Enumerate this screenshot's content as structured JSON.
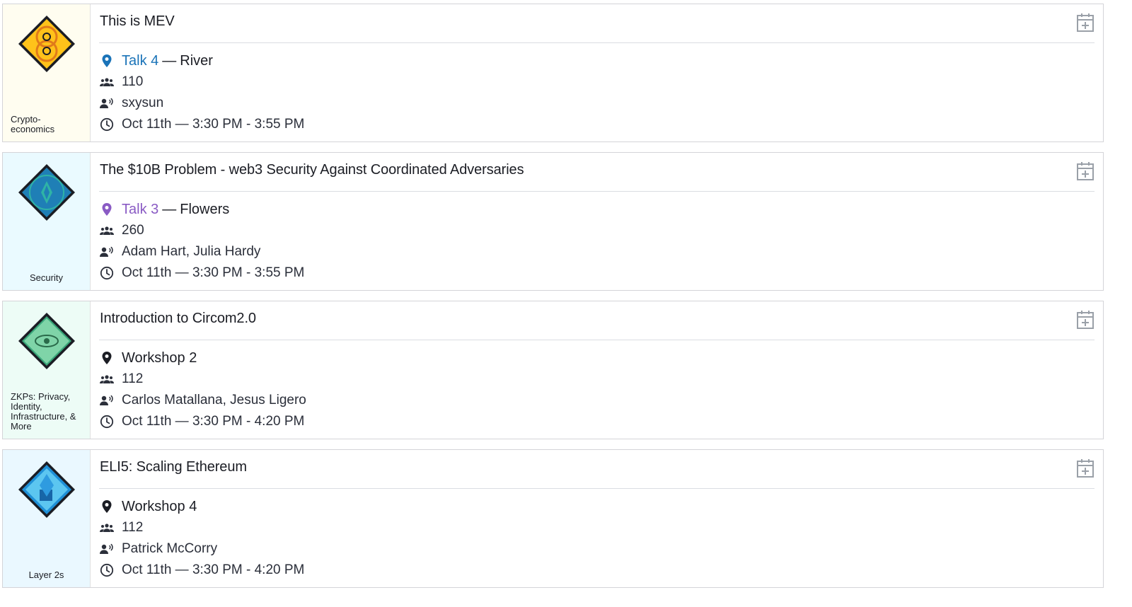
{
  "sessions": [
    {
      "title": "This is MEV",
      "track": "Crypto-\neconomics",
      "track_lines": [
        "Crypto-",
        "economics"
      ],
      "badge_colors": {
        "bg": "#fffdf0",
        "outer": "#ffc21a",
        "inner": "#e07a1a",
        "border": "#1b1d24"
      },
      "badge_icon": "cryptoeconomics-badge-icon",
      "location_type": "Talk 4",
      "location_separator": "—",
      "location_room": "River",
      "location_color": "#1a73b8",
      "attendees": "110",
      "speakers": "sxysun",
      "time": "Oct 11th — 3:30 PM - 3:55 PM"
    },
    {
      "title": "The $10B Problem - web3 Security Against Coordinated Adversaries",
      "track": "Security",
      "track_lines": [
        "Security"
      ],
      "badge_colors": {
        "bg": "#eafaff",
        "outer": "#1f7fb6",
        "inner": "#2fb3a6",
        "border": "#1b1d24"
      },
      "badge_icon": "security-badge-icon",
      "location_type": "Talk 3",
      "location_separator": "—",
      "location_room": "Flowers",
      "location_color": "#8a5bc4",
      "attendees": "260",
      "speakers": "Adam Hart, Julia Hardy",
      "time": "Oct 11th — 3:30 PM - 3:55 PM"
    },
    {
      "title": "Introduction to Circom2.0",
      "track": "ZKPs: Privacy, Identity, Infrastructure, & More",
      "track_lines": [
        "ZKPs: Privacy,",
        "Identity,",
        "Infrastructure, &",
        "More"
      ],
      "badge_colors": {
        "bg": "#edfcf6",
        "outer": "#3aa77a",
        "inner": "#7fd4a8",
        "border": "#1b1d24"
      },
      "badge_icon": "zkp-badge-icon",
      "location_type": "Workshop 2",
      "location_separator": "",
      "location_room": "",
      "location_color": "#1b1d24",
      "attendees": "112",
      "speakers": "Carlos Matallana, Jesus Ligero",
      "time": "Oct 11th — 3:30 PM - 4:20 PM"
    },
    {
      "title": "ELI5: Scaling Ethereum",
      "track": "Layer 2s",
      "track_lines": [
        "Layer 2s"
      ],
      "badge_colors": {
        "bg": "#eaf8ff",
        "outer": "#1e8fd6",
        "inner": "#5cc6f0",
        "border": "#1b1d24"
      },
      "badge_icon": "layer2-badge-icon",
      "location_type": "Workshop 4",
      "location_separator": "",
      "location_room": "",
      "location_color": "#1b1d24",
      "attendees": "112",
      "speakers": "Patrick McCorry",
      "time": "Oct 11th — 3:30 PM - 4:20 PM"
    }
  ],
  "icons": {
    "location": "map-pin-icon",
    "attendees": "people-icon",
    "speakers": "speaker-icon",
    "time": "clock-icon",
    "add_to_calendar": "calendar-add-icon"
  }
}
